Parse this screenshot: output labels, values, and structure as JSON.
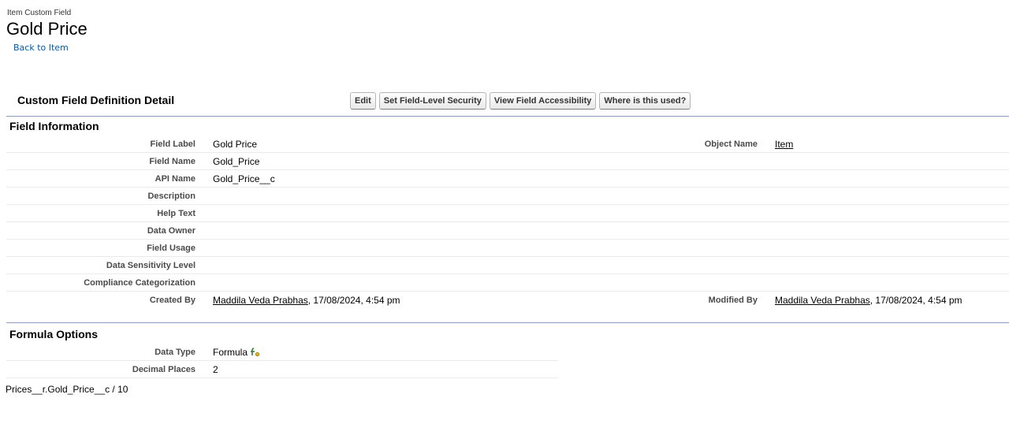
{
  "header": {
    "type_label": "Item Custom Field",
    "title": "Gold Price",
    "back_link": "Back to Item"
  },
  "detail": {
    "section_title": "Custom Field Definition Detail",
    "buttons": {
      "edit": "Edit",
      "fls": "Set Field-Level Security",
      "access": "View Field Accessibility",
      "used": "Where is this used?"
    }
  },
  "field_info": {
    "title": "Field Information",
    "rows": [
      {
        "label": "Field Label",
        "value": "Gold Price",
        "label2": "Object Name",
        "value2": "Item"
      },
      {
        "label": "Field Name",
        "value": "Gold_Price"
      },
      {
        "label": "API Name",
        "value": "Gold_Price__c"
      },
      {
        "label": "Description",
        "value": ""
      },
      {
        "label": "Help Text",
        "value": ""
      },
      {
        "label": "Data Owner",
        "value": ""
      },
      {
        "label": "Field Usage",
        "value": ""
      },
      {
        "label": "Data Sensitivity Level",
        "value": ""
      },
      {
        "label": "Compliance Categorization",
        "value": ""
      }
    ],
    "created": {
      "label": "Created By",
      "user": "Maddila Veda Prabhas",
      "date": ", 17/08/2024, 4:54 pm",
      "label2": "Modified By",
      "user2": "Maddila Veda Prabhas",
      "date2": ", 17/08/2024, 4:54 pm"
    }
  },
  "formula_options": {
    "title": "Formula Options",
    "data_type_label": "Data Type",
    "data_type_value": "Formula",
    "decimal_label": "Decimal Places",
    "decimal_value": "2",
    "formula": "Prices__r.Gold_Price__c / 10"
  },
  "icons": {
    "formula": "formula-icon"
  }
}
